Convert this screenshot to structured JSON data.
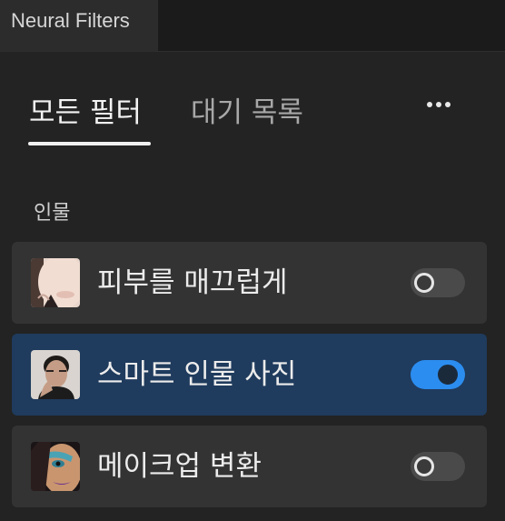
{
  "panel": {
    "title": "Neural Filters"
  },
  "tabs": {
    "all_filters": "모든 필터",
    "wait_list": "대기 목록",
    "active": "all_filters"
  },
  "more_menu": {
    "icon": "more-horizontal-icon"
  },
  "section": {
    "label": "인물"
  },
  "filters": [
    {
      "label": "피부를 매끄럽게",
      "enabled": false,
      "thumbnail": "skin-face-thumbnail"
    },
    {
      "label": "스마트 인물 사진",
      "enabled": true,
      "thumbnail": "portrait-man-thumbnail"
    },
    {
      "label": "메이크업 변환",
      "enabled": false,
      "thumbnail": "makeup-face-thumbnail"
    }
  ],
  "colors": {
    "background": "#232323",
    "item_background": "#333333",
    "item_active_background": "#1f3b5d",
    "toggle_on": "#2c8df0",
    "toggle_off": "#4a4a4a"
  }
}
